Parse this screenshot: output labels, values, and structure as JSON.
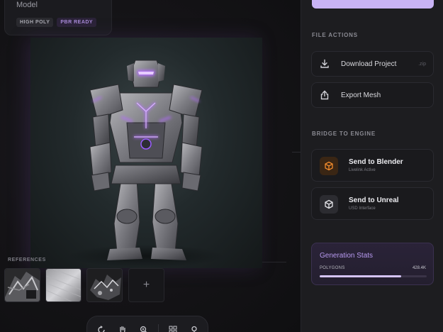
{
  "model_card": {
    "title": "Model",
    "badges": [
      "HIGH POLY",
      "PBR READY"
    ]
  },
  "references": {
    "label": "REFERENCES",
    "add_label": "+"
  },
  "toolbar": {
    "icons": [
      "rotate-icon",
      "pan-hand-icon",
      "zoom-icon",
      "grid-icon",
      "pin-icon"
    ]
  },
  "sidebar": {
    "file_actions_label": "FILE ACTIONS",
    "file_actions": [
      {
        "label": "Download Project",
        "ext": ".zip",
        "icon": "download-icon"
      },
      {
        "label": "Export Mesh",
        "ext": "",
        "icon": "share-icon"
      }
    ],
    "bridge_label": "BRIDGE TO ENGINE",
    "engines": [
      {
        "name": "Send to Blender",
        "sub": "Livelink Active",
        "icon": "blender-cube-icon",
        "accent": "#f08a2c"
      },
      {
        "name": "Send to Unreal",
        "sub": "USD Interface",
        "icon": "unreal-cube-icon",
        "accent": "#e6e6ea"
      }
    ],
    "stats": {
      "title": "Generation Stats",
      "key": "POLYGONS",
      "value": "428.4K",
      "progress": 0.76
    }
  },
  "colors": {
    "accent": "#c9b3f5",
    "stats_title": "#b89af0",
    "glow": "#a45cff"
  }
}
